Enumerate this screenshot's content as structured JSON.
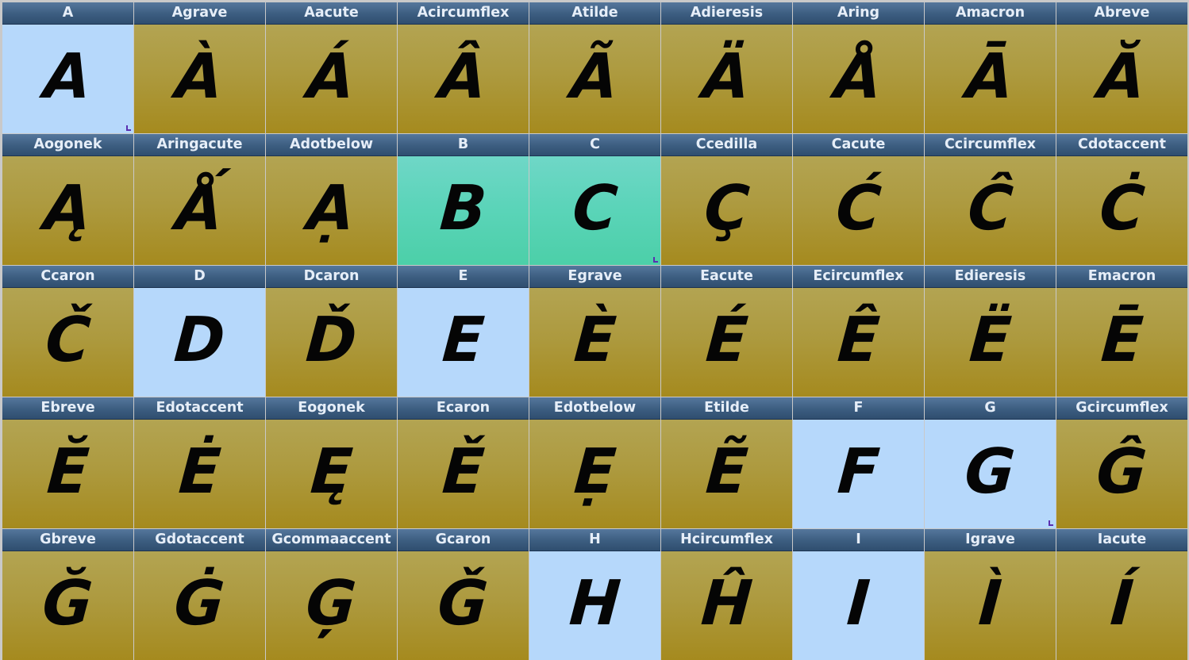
{
  "glyph_grid": {
    "cells": [
      {
        "name": "A",
        "char": "A",
        "state": "blue",
        "marker": true
      },
      {
        "name": "Agrave",
        "char": "À",
        "state": "default",
        "marker": false
      },
      {
        "name": "Aacute",
        "char": "Á",
        "state": "default",
        "marker": false
      },
      {
        "name": "Acircumflex",
        "char": "Â",
        "state": "default",
        "marker": false
      },
      {
        "name": "Atilde",
        "char": "Ã",
        "state": "default",
        "marker": false
      },
      {
        "name": "Adieresis",
        "char": "Ä",
        "state": "default",
        "marker": false
      },
      {
        "name": "Aring",
        "char": "Å",
        "state": "default",
        "marker": false
      },
      {
        "name": "Amacron",
        "char": "Ā",
        "state": "default",
        "marker": false
      },
      {
        "name": "Abreve",
        "char": "Ă",
        "state": "default",
        "marker": false
      },
      {
        "name": "Aogonek",
        "char": "Ą",
        "state": "default",
        "marker": false
      },
      {
        "name": "Aringacute",
        "char": "Ǻ",
        "state": "default",
        "marker": false
      },
      {
        "name": "Adotbelow",
        "char": "Ạ",
        "state": "default",
        "marker": false
      },
      {
        "name": "B",
        "char": "B",
        "state": "teal",
        "marker": false
      },
      {
        "name": "C",
        "char": "C",
        "state": "teal",
        "marker": true
      },
      {
        "name": "Ccedilla",
        "char": "Ç",
        "state": "default",
        "marker": false
      },
      {
        "name": "Cacute",
        "char": "Ć",
        "state": "default",
        "marker": false
      },
      {
        "name": "Ccircumflex",
        "char": "Ĉ",
        "state": "default",
        "marker": false
      },
      {
        "name": "Cdotaccent",
        "char": "Ċ",
        "state": "default",
        "marker": false
      },
      {
        "name": "Ccaron",
        "char": "Č",
        "state": "default",
        "marker": false
      },
      {
        "name": "D",
        "char": "D",
        "state": "blue",
        "marker": false
      },
      {
        "name": "Dcaron",
        "char": "Ď",
        "state": "default",
        "marker": false
      },
      {
        "name": "E",
        "char": "E",
        "state": "blue",
        "marker": false
      },
      {
        "name": "Egrave",
        "char": "È",
        "state": "default",
        "marker": false
      },
      {
        "name": "Eacute",
        "char": "É",
        "state": "default",
        "marker": false
      },
      {
        "name": "Ecircumflex",
        "char": "Ê",
        "state": "default",
        "marker": false
      },
      {
        "name": "Edieresis",
        "char": "Ë",
        "state": "default",
        "marker": false
      },
      {
        "name": "Emacron",
        "char": "Ē",
        "state": "default",
        "marker": false
      },
      {
        "name": "Ebreve",
        "char": "Ĕ",
        "state": "default",
        "marker": false
      },
      {
        "name": "Edotaccent",
        "char": "Ė",
        "state": "default",
        "marker": false
      },
      {
        "name": "Eogonek",
        "char": "Ę",
        "state": "default",
        "marker": false
      },
      {
        "name": "Ecaron",
        "char": "Ě",
        "state": "default",
        "marker": false
      },
      {
        "name": "Edotbelow",
        "char": "Ẹ",
        "state": "default",
        "marker": false
      },
      {
        "name": "Etilde",
        "char": "Ẽ",
        "state": "default",
        "marker": false
      },
      {
        "name": "F",
        "char": "F",
        "state": "blue",
        "marker": false
      },
      {
        "name": "G",
        "char": "G",
        "state": "blue",
        "marker": true
      },
      {
        "name": "Gcircumflex",
        "char": "Ĝ",
        "state": "default",
        "marker": false
      },
      {
        "name": "Gbreve",
        "char": "Ğ",
        "state": "default",
        "marker": false
      },
      {
        "name": "Gdotaccent",
        "char": "Ġ",
        "state": "default",
        "marker": false
      },
      {
        "name": "Gcommaaccent",
        "char": "Ģ",
        "state": "default",
        "marker": false
      },
      {
        "name": "Gcaron",
        "char": "Ǧ",
        "state": "default",
        "marker": false
      },
      {
        "name": "H",
        "char": "H",
        "state": "blue",
        "marker": false
      },
      {
        "name": "Hcircumflex",
        "char": "Ĥ",
        "state": "default",
        "marker": false
      },
      {
        "name": "I",
        "char": "I",
        "state": "blue",
        "marker": false
      },
      {
        "name": "Igrave",
        "char": "Ì",
        "state": "default",
        "marker": false
      },
      {
        "name": "Iacute",
        "char": "Í",
        "state": "default",
        "marker": false
      }
    ]
  }
}
